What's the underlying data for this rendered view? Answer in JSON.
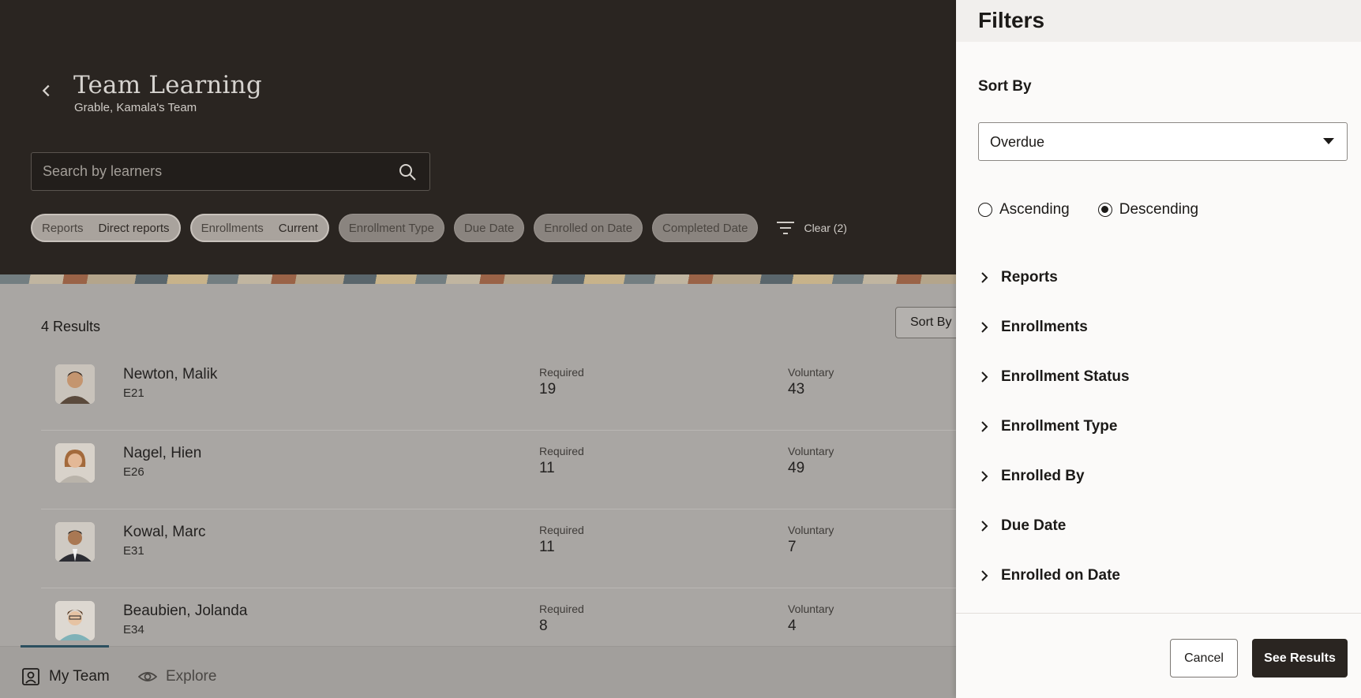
{
  "header": {
    "title": "Team Learning",
    "subtitle": "Grable, Kamala's Team",
    "search_placeholder": "Search by learners",
    "chips": [
      {
        "label": "Reports",
        "value": "Direct reports"
      },
      {
        "label": "Enrollments",
        "value": "Current"
      },
      {
        "label": "Enrollment Type"
      },
      {
        "label": "Due Date"
      },
      {
        "label": "Enrolled on Date"
      },
      {
        "label": "Completed Date"
      }
    ],
    "clear_label": "Clear (2)"
  },
  "results": {
    "count_label": "4 Results",
    "sort_button_label": "Sort By",
    "rows": [
      {
        "name": "Newton, Malik",
        "id": "E21",
        "required_label": "Required",
        "required": "19",
        "voluntary_label": "Voluntary",
        "voluntary": "43"
      },
      {
        "name": "Nagel, Hien",
        "id": "E26",
        "required_label": "Required",
        "required": "11",
        "voluntary_label": "Voluntary",
        "voluntary": "49"
      },
      {
        "name": "Kowal, Marc",
        "id": "E31",
        "required_label": "Required",
        "required": "11",
        "voluntary_label": "Voluntary",
        "voluntary": "7"
      },
      {
        "name": "Beaubien, Jolanda",
        "id": "E34",
        "required_label": "Required",
        "required": "8",
        "voluntary_label": "Voluntary",
        "voluntary": "4"
      }
    ]
  },
  "bottom_nav": {
    "my_team": "My Team",
    "explore": "Explore"
  },
  "filters": {
    "title": "Filters",
    "sort_by_label": "Sort By",
    "sort_by_value": "Overdue",
    "ascending": "Ascending",
    "descending": "Descending",
    "selected_order": "Descending",
    "sections": [
      "Reports",
      "Enrollments",
      "Enrollment Status",
      "Enrollment Type",
      "Enrolled By",
      "Due Date",
      "Enrolled on Date"
    ],
    "cancel": "Cancel",
    "see_results": "See Results"
  }
}
